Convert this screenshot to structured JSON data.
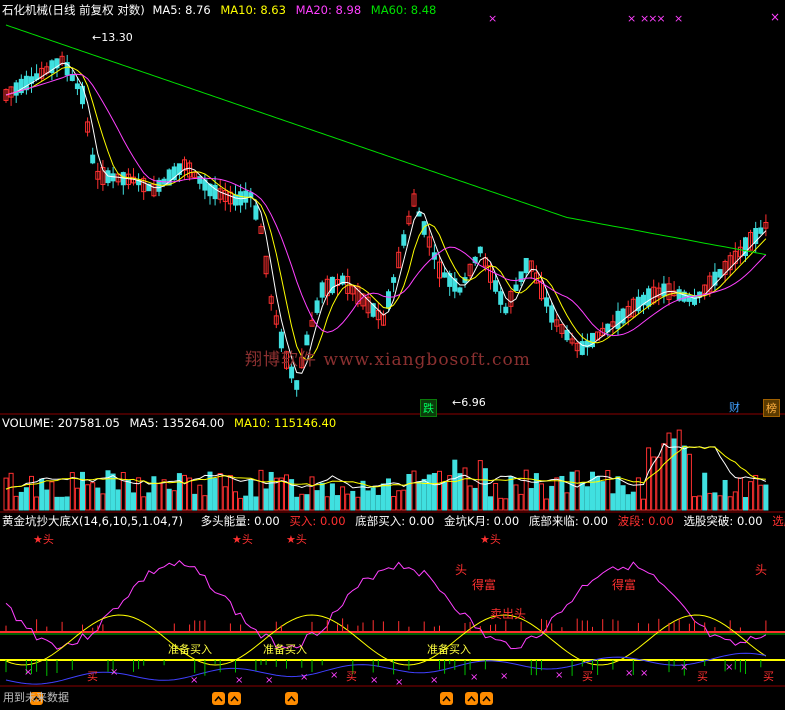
{
  "colors": {
    "background": "#000000",
    "grid_line": "#8b0000",
    "up_candle": "#ff3030",
    "down_candle": "#40e0e0",
    "ma5": "#ffffff",
    "ma10": "#ffff00",
    "ma20": "#ff40ff",
    "ma60": "#00e000",
    "watermark": "#8b3030"
  },
  "price_panel": {
    "title": "石化机械(日线 前复权 对数)",
    "ma5_label": "MA5:",
    "ma5_value": "8.76",
    "ma10_label": "MA10:",
    "ma10_value": "8.63",
    "ma20_label": "MA20:",
    "ma20_value": "8.98",
    "ma60_label": "MA60:",
    "ma60_value": "8.48",
    "high_marker": "13.30",
    "low_marker": "6.96",
    "event_tag_die": "跌",
    "event_tag_cai": "财",
    "event_tag_bang": "榜",
    "top_marks": [
      "×",
      "×",
      "×××",
      "×",
      "×"
    ],
    "watermark": "翔博软件 www.xiangbosoft.com"
  },
  "volume_panel": {
    "label": "VOLUME:",
    "value": "207581.05",
    "ma5_label": "MA5:",
    "ma5_value": "135264.00",
    "ma10_label": "MA10:",
    "ma10_value": "115146.40"
  },
  "indicator_panel": {
    "name": "黄金坑抄大底X(14,6,10,5,1.04,7)",
    "duotou_label": "多头能量:",
    "duotou_value": "0.00",
    "buy_label": "买入:",
    "buy_value": "0.00",
    "dibu_buy_label": "底部买入:",
    "dibu_buy_value": "0.00",
    "jinkeng_label": "金坑K月:",
    "jinkeng_value": "0.00",
    "dibu_come_label": "底部来临:",
    "dibu_come_value": "0.00",
    "bodu_label": "波段:",
    "bodu_value": "0.00",
    "select_break_label": "选股突破:",
    "select_break_value": "0.00",
    "select_nb_label": "选股NB:",
    "tag_head_star": "★头",
    "tag_head": "头",
    "tag_rich": "得富",
    "tag_ready_buy": "准备买入",
    "tag_ready_buy2": "准备买入",
    "tag_ready_buy3": "准备买入",
    "tag_buy": "买",
    "tag_sell_scene": "卖出头",
    "footer": "用到未来数据"
  },
  "chart_data": {
    "type": "candlestick",
    "series": [
      {
        "name": "MA5",
        "values": [
          8.76
        ]
      },
      {
        "name": "MA10",
        "values": [
          8.63
        ]
      },
      {
        "name": "MA20",
        "values": [
          8.98
        ]
      },
      {
        "name": "MA60",
        "values": [
          8.48
        ]
      }
    ],
    "annotations": [
      "13.30",
      "6.96"
    ],
    "volume": {
      "last": 207581.05,
      "ma5": 135264.0,
      "ma10": 115146.4
    },
    "y_scale": "log",
    "grid": false
  }
}
